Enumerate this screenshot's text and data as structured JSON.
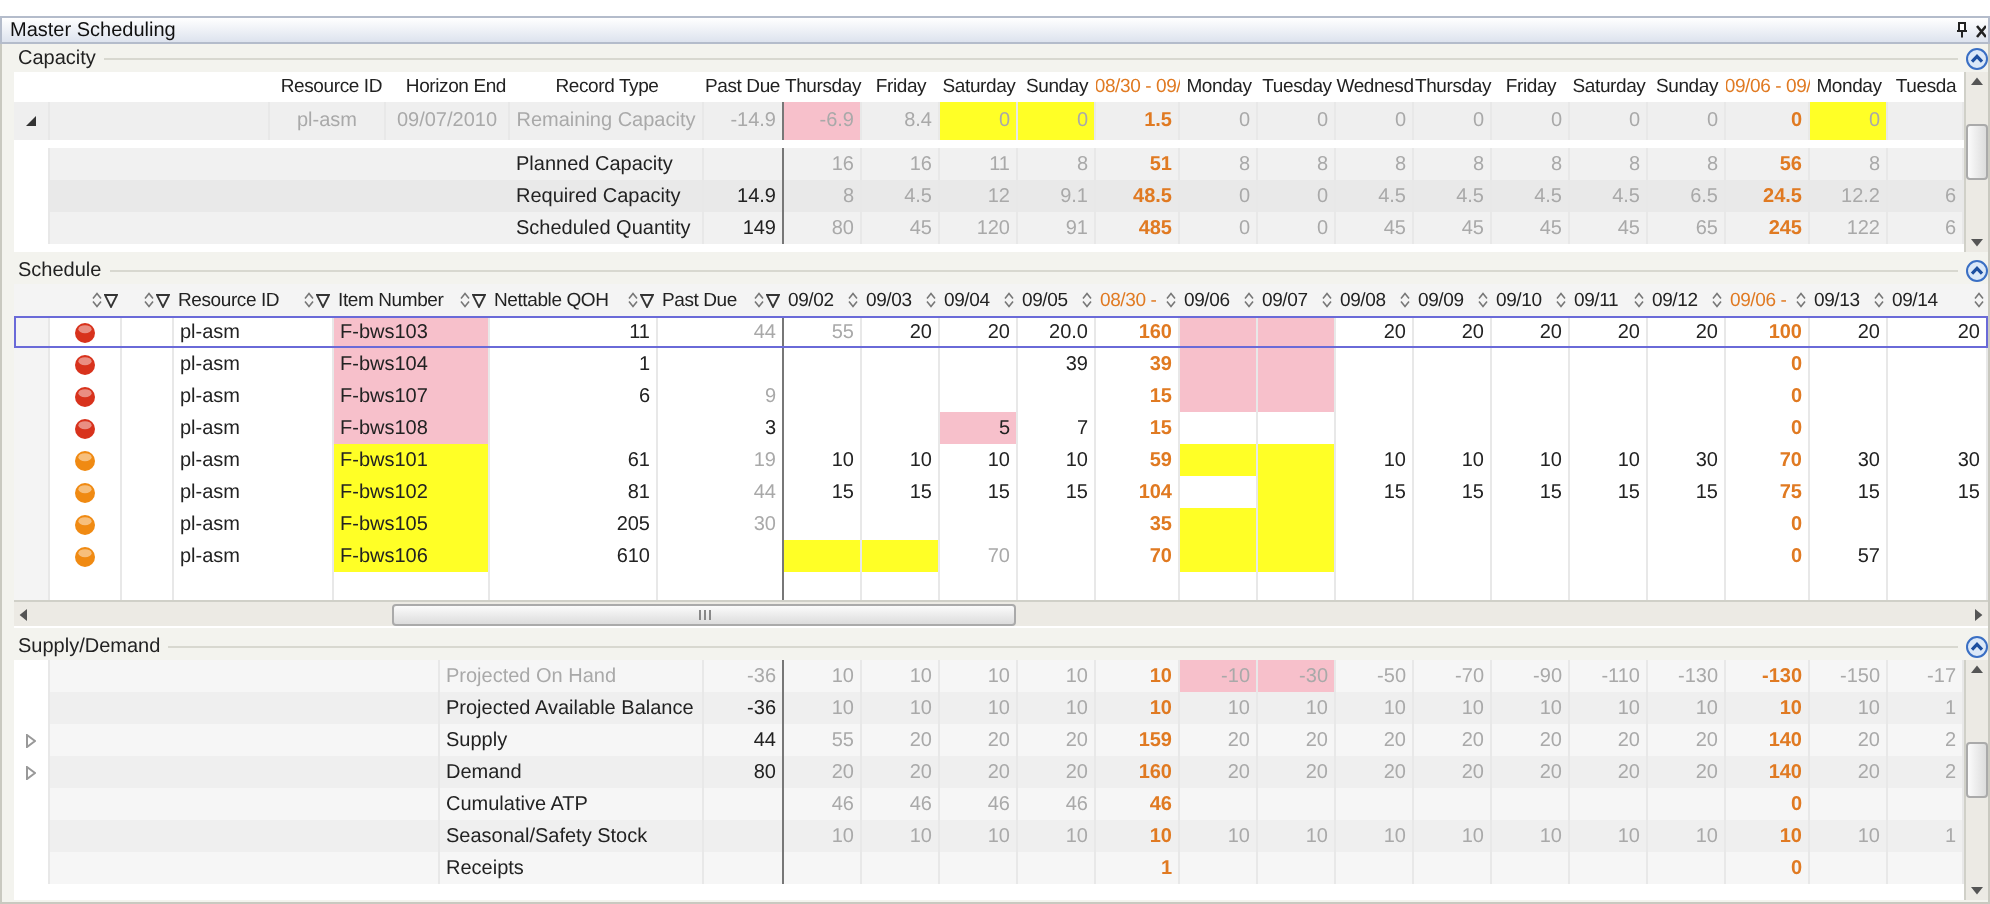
{
  "window": {
    "title": "Master Scheduling"
  },
  "capacity": {
    "title": "Capacity",
    "columns": [
      "Resource ID",
      "Horizon End",
      "Record Type",
      "Past Due"
    ],
    "periods": [
      {
        "label": "Thursday",
        "summary": false
      },
      {
        "label": "Friday",
        "summary": false
      },
      {
        "label": "Saturday",
        "summary": false
      },
      {
        "label": "Sunday",
        "summary": false
      },
      {
        "label": "08/30 - 09/",
        "summary": true
      },
      {
        "label": "Monday",
        "summary": false
      },
      {
        "label": "Tuesday",
        "summary": false
      },
      {
        "label": "Wednesd",
        "summary": false
      },
      {
        "label": "Thursday",
        "summary": false
      },
      {
        "label": "Friday",
        "summary": false
      },
      {
        "label": "Saturday",
        "summary": false
      },
      {
        "label": "Sunday",
        "summary": false
      },
      {
        "label": "09/06 - 09/",
        "summary": true
      },
      {
        "label": "Monday",
        "summary": false
      },
      {
        "label": "Tuesda",
        "summary": false
      }
    ],
    "rows": [
      {
        "kind": "resource",
        "expanded": true,
        "resource_id": "pl-asm",
        "horizon_end": "09/07/2010",
        "record_type": "Remaining Capacity",
        "past_due": "-14.9",
        "cells": [
          {
            "value": "-6.9",
            "shortage": true
          },
          "8.4",
          {
            "value": "0",
            "excess": true
          },
          {
            "value": "0",
            "excess": true
          },
          "1.5",
          "0",
          "0",
          "0",
          "0",
          "0",
          "0",
          "0",
          "0",
          {
            "value": "0",
            "excess": true
          },
          null
        ]
      },
      {
        "kind": "measure",
        "record_type": "Planned Capacity",
        "past_due": null,
        "cells": [
          "16",
          "16",
          "11",
          "8",
          "51",
          "8",
          "8",
          "8",
          "8",
          "8",
          "8",
          "8",
          "56",
          "8",
          null
        ]
      },
      {
        "kind": "measure",
        "record_type": "Required Capacity",
        "past_due": "14.9",
        "cells": [
          "8",
          "4.5",
          "12",
          "9.1",
          "48.5",
          "0",
          "0",
          "4.5",
          "4.5",
          "4.5",
          "4.5",
          "6.5",
          "24.5",
          "12.2",
          "6"
        ]
      },
      {
        "kind": "measure",
        "record_type": "Scheduled Quantity",
        "past_due": "149",
        "cells": [
          "80",
          "45",
          "120",
          "91",
          "485",
          "0",
          "0",
          "45",
          "45",
          "45",
          "45",
          "65",
          "245",
          "122",
          "6"
        ]
      }
    ]
  },
  "schedule": {
    "title": "Schedule",
    "columns": [
      "Resource ID",
      "Item Number",
      "Nettable QOH",
      "Past Due"
    ],
    "periods": [
      {
        "label": "09/02",
        "summary": false
      },
      {
        "label": "09/03",
        "summary": false
      },
      {
        "label": "09/04",
        "summary": false
      },
      {
        "label": "09/05",
        "summary": false
      },
      {
        "label": "08/30 -",
        "summary": true
      },
      {
        "label": "09/06",
        "summary": false
      },
      {
        "label": "09/07",
        "summary": false
      },
      {
        "label": "09/08",
        "summary": false
      },
      {
        "label": "09/09",
        "summary": false
      },
      {
        "label": "09/10",
        "summary": false
      },
      {
        "label": "09/11",
        "summary": false
      },
      {
        "label": "09/12",
        "summary": false
      },
      {
        "label": "09/06 -",
        "summary": true
      },
      {
        "label": "09/13",
        "summary": false
      },
      {
        "label": "09/14",
        "summary": false
      }
    ],
    "rows": [
      {
        "color": "#d8321c",
        "selected": true,
        "resource_id": "pl-asm",
        "item_number": "F-bws103",
        "item_shortage": true,
        "nettable_qoh": "11",
        "past_due": {
          "value": "44",
          "dim": true
        },
        "cells": [
          {
            "value": "55",
            "dim": true
          },
          "20",
          "20",
          "20.0",
          "160",
          {
            "shortage": true
          },
          {
            "shortage": true
          },
          "20",
          "20",
          "20",
          "20",
          "20",
          "100",
          "20",
          "20"
        ]
      },
      {
        "color": "#d8321c",
        "selected": false,
        "resource_id": "pl-asm",
        "item_number": "F-bws104",
        "item_shortage": true,
        "nettable_qoh": "1",
        "past_due": null,
        "cells": [
          null,
          null,
          null,
          "39",
          "39",
          {
            "shortage": true
          },
          {
            "shortage": true
          },
          null,
          null,
          null,
          null,
          null,
          "0",
          null,
          null
        ]
      },
      {
        "color": "#d8321c",
        "selected": false,
        "resource_id": "pl-asm",
        "item_number": "F-bws107",
        "item_shortage": true,
        "nettable_qoh": "6",
        "past_due": {
          "value": "9",
          "dim": true
        },
        "cells": [
          null,
          null,
          null,
          null,
          "15",
          {
            "shortage": true
          },
          {
            "shortage": true
          },
          null,
          null,
          null,
          null,
          null,
          "0",
          null,
          null
        ]
      },
      {
        "color": "#d8321c",
        "selected": false,
        "resource_id": "pl-asm",
        "item_number": "F-bws108",
        "item_shortage": true,
        "nettable_qoh": null,
        "past_due": "3",
        "cells": [
          null,
          null,
          {
            "value": "5",
            "shortage": true
          },
          "7",
          "15",
          null,
          null,
          null,
          null,
          null,
          null,
          null,
          "0",
          null,
          null
        ]
      },
      {
        "color": "#f08a12",
        "selected": false,
        "resource_id": "pl-asm",
        "item_number": "F-bws101",
        "item_shortage": false,
        "nettable_qoh": "61",
        "past_due": {
          "value": "19",
          "dim": true
        },
        "cells": [
          "10",
          "10",
          "10",
          "10",
          "59",
          {
            "excess": true
          },
          {
            "excess": true
          },
          "10",
          "10",
          "10",
          "10",
          "30",
          "70",
          "30",
          "30"
        ]
      },
      {
        "color": "#f08a12",
        "selected": false,
        "resource_id": "pl-asm",
        "item_number": "F-bws102",
        "item_shortage": false,
        "nettable_qoh": "81",
        "past_due": {
          "value": "44",
          "dim": true
        },
        "cells": [
          "15",
          "15",
          "15",
          "15",
          "104",
          null,
          {
            "excess": true
          },
          "15",
          "15",
          "15",
          "15",
          "15",
          "75",
          "15",
          "15"
        ]
      },
      {
        "color": "#f08a12",
        "selected": false,
        "resource_id": "pl-asm",
        "item_number": "F-bws105",
        "item_shortage": false,
        "nettable_qoh": "205",
        "past_due": {
          "value": "30",
          "dim": true
        },
        "cells": [
          null,
          null,
          null,
          null,
          "35",
          {
            "excess": true
          },
          {
            "excess": true
          },
          null,
          null,
          null,
          null,
          null,
          "0",
          null,
          null
        ]
      },
      {
        "color": "#f08a12",
        "selected": false,
        "resource_id": "pl-asm",
        "item_number": "F-bws106",
        "item_shortage": false,
        "nettable_qoh": "610",
        "past_due": null,
        "cells": [
          {
            "excess": true
          },
          {
            "excess": true
          },
          {
            "value": "70",
            "dim": true
          },
          null,
          "70",
          {
            "excess": true
          },
          {
            "excess": true
          },
          null,
          null,
          null,
          null,
          null,
          "0",
          "57",
          null
        ]
      }
    ]
  },
  "supply_demand": {
    "title": "Supply/Demand",
    "rows": [
      {
        "label": "Projected On Hand",
        "dim": true,
        "past_due": {
          "value": "-36",
          "dim": true
        },
        "cells": [
          "10",
          "10",
          "10",
          "10",
          "10",
          {
            "value": "-10",
            "shortage": true
          },
          {
            "value": "-30",
            "shortage": true
          },
          "-50",
          "-70",
          "-90",
          "-110",
          "-130",
          "-130",
          "-150",
          "-17"
        ]
      },
      {
        "label": "Projected Available Balance",
        "dim": false,
        "past_due": "-36",
        "cells": [
          "10",
          "10",
          "10",
          "10",
          "10",
          "10",
          "10",
          "10",
          "10",
          "10",
          "10",
          "10",
          "10",
          "10",
          "1"
        ]
      },
      {
        "label": "Supply",
        "dim": false,
        "expandable": true,
        "past_due": "44",
        "cells": [
          "55",
          "20",
          "20",
          "20",
          "159",
          "20",
          "20",
          "20",
          "20",
          "20",
          "20",
          "20",
          "140",
          "20",
          "2"
        ]
      },
      {
        "label": "Demand",
        "dim": false,
        "expandable": true,
        "past_due": "80",
        "cells": [
          "20",
          "20",
          "20",
          "20",
          "160",
          "20",
          "20",
          "20",
          "20",
          "20",
          "20",
          "20",
          "140",
          "20",
          "2"
        ]
      },
      {
        "label": "Cumulative ATP",
        "dim": false,
        "past_due": null,
        "cells": [
          "46",
          "46",
          "46",
          "46",
          "46",
          null,
          null,
          null,
          null,
          null,
          null,
          null,
          "0",
          null,
          null
        ]
      },
      {
        "label": "Seasonal/Safety Stock",
        "dim": false,
        "past_due": null,
        "cells": [
          "10",
          "10",
          "10",
          "10",
          "10",
          "10",
          "10",
          "10",
          "10",
          "10",
          "10",
          "10",
          "10",
          "10",
          "1"
        ]
      },
      {
        "label": "Receipts",
        "dim": false,
        "past_due": null,
        "cells": [
          null,
          null,
          null,
          null,
          "1",
          null,
          null,
          null,
          null,
          null,
          null,
          null,
          "0",
          null,
          null
        ]
      }
    ]
  }
}
